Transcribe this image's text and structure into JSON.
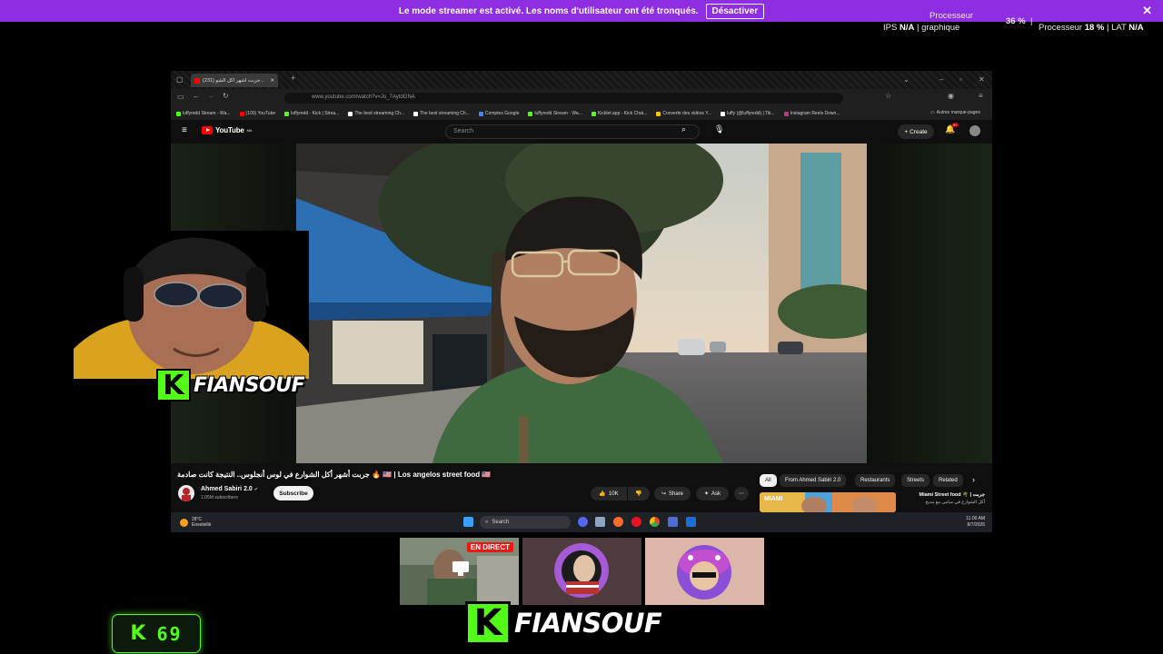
{
  "streamer_banner": {
    "message": "Le mode streamer est activé. Les noms d'utilisateur ont été tronqués.",
    "button_label": "Désactiver",
    "close": "✕"
  },
  "perf_overlay": {
    "ips_label": "IPS",
    "ips_value": "N/A",
    "gpu_label_top": "Processeur",
    "gpu_label_bottom": "graphique",
    "gpu_value": "36 %",
    "cpu_label": "Processeur",
    "cpu_value": "18 %",
    "lat_label": "LAT",
    "lat_value": "N/A",
    "sep": "|"
  },
  "browser": {
    "tab_title": "(231) جربت أشهر أكل الشو...",
    "url": "www.youtube.com/watch?v=Jo_7AytdGNA",
    "bookmarks": [
      {
        "label": "luffyredd Stream - Wa...",
        "color": "#53fc18"
      },
      {
        "label": "(100) YouTube",
        "color": "#ff0000"
      },
      {
        "label": "luffyredd - Kick | Strea...",
        "color": "#53fc18"
      },
      {
        "label": "The best streaming Ch...",
        "color": "#ffffff"
      },
      {
        "label": "The best streaming Ch...",
        "color": "#ffffff"
      },
      {
        "label": "Comptes Google",
        "color": "#4285f4"
      },
      {
        "label": "luffyredd Stream - Wa...",
        "color": "#53fc18"
      },
      {
        "label": "Kicklet.app - Kick Chat...",
        "color": "#53fc18"
      },
      {
        "label": "Convertir des vidéos Y...",
        "color": "#f7c600"
      },
      {
        "label": "luffy (@luffyredd) | Tik...",
        "color": "#ffffff"
      },
      {
        "label": "Instagram Reels Down...",
        "color": "#c13584"
      }
    ],
    "bookmarks_more": "Autres marque-pages"
  },
  "youtube": {
    "logo_text": "YouTube",
    "country_code": "MA",
    "search_placeholder": "Search",
    "create_label": "Create",
    "notif_count": "9+",
    "video_title": "جربت أشهر أكل الشوارع في لوس أنجلوس.. النتيجة كانت صادمة 🔥 🇺🇸 | Los angelos street food 🇺🇸",
    "channel_name": "Ahmed Sabiri 2.0",
    "channel_subs": "1.05M subscribers",
    "subscribe_label": "Subscribe",
    "likes": "10K",
    "share_label": "Share",
    "ask_label": "Ask",
    "chips": [
      "All",
      "From Ahmed Sabiri 2.0",
      "Restaurants",
      "Streets",
      "Related"
    ],
    "rec_title": "جربت | 🌴 Miami Street food",
    "rec_sub": "أكل الشوارع في ميامي مع مديح",
    "rec_thumb_text": "MIAMI"
  },
  "taskbar": {
    "temp": "28°C",
    "weather": "Ensoleillé",
    "search": "Search",
    "time": "11:00 AM",
    "date": "8/7/2026"
  },
  "overlay": {
    "streamer_name": "FIANSOUF",
    "kick_letter": "K",
    "live_badge": "EN DIRECT",
    "viewer_count": "69"
  }
}
